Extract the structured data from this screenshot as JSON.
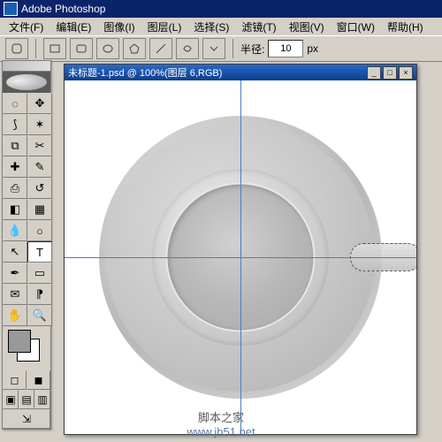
{
  "app": {
    "title": "Adobe Photoshop"
  },
  "menu": {
    "file": "文件(F)",
    "edit": "编辑(E)",
    "image": "图像(I)",
    "layer": "图层(L)",
    "select": "选择(S)",
    "filter": "滤镜(T)",
    "view": "视图(V)",
    "window": "窗口(W)",
    "help": "帮助(H)"
  },
  "options": {
    "radius_label": "半径:",
    "radius_value": "10",
    "radius_unit": "px"
  },
  "document": {
    "title": "未标题-1.psd @ 100%(图层 6,RGB)"
  },
  "tools": {
    "marquee": "selection",
    "move": "move",
    "lasso": "lasso",
    "wand": "magic-wand",
    "crop": "crop",
    "slice": "slice",
    "heal": "healing",
    "brush": "brush",
    "stamp": "clone",
    "history": "history-brush",
    "eraser": "eraser",
    "gradient": "gradient",
    "blur": "blur",
    "dodge": "dodge",
    "path": "path-select",
    "type": "type",
    "pen": "pen",
    "shape": "shape",
    "notes": "notes",
    "eyedrop": "eyedropper",
    "hand": "hand",
    "zoom": "zoom"
  },
  "watermark": {
    "line1": "脚本之家",
    "line2": "www.jb51.net"
  }
}
